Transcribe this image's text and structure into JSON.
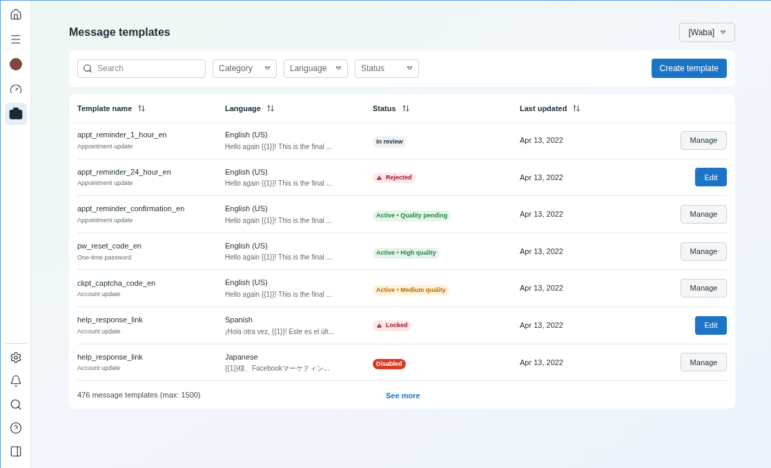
{
  "sidebar": {
    "top_items": [
      {
        "selected": false
      },
      {
        "selected": false
      },
      {
        "selected": false
      },
      {
        "selected": false
      },
      {
        "selected": true
      }
    ],
    "bottom_items": [
      {
        "selected": false
      },
      {
        "selected": false
      },
      {
        "selected": false
      },
      {
        "selected": false
      },
      {
        "selected": false
      }
    ]
  },
  "page": {
    "title": "Message templates",
    "account_selector": "[Waba]"
  },
  "filters": {
    "search": {
      "placeholder": "Search"
    },
    "dropdowns": [
      "Category",
      "Language",
      "Status"
    ],
    "create_button": "Create template"
  },
  "table": {
    "columns": [
      "Template name",
      "Language",
      "Status",
      "Last updated"
    ],
    "rows": [
      {
        "name": "appt_reminder_1_hour_en",
        "category": "Appointment update",
        "language": "English (US)",
        "preview": "Hello again {{1}}! This is the final ...",
        "status": {
          "label": "In review",
          "kind": "neutral"
        },
        "updated": "Apr 13, 2022",
        "action": {
          "label": "Manage",
          "kind": "secondary"
        }
      },
      {
        "name": "appt_reminder_24_hour_en",
        "category": "Appointment update",
        "language": "English (US)",
        "preview": "Hello again {{1}}! This is the final ...",
        "status": {
          "label": "Rejected",
          "kind": "error"
        },
        "updated": "Apr 13, 2022",
        "action": {
          "label": "Edit",
          "kind": "primary"
        }
      },
      {
        "name": "appt_reminder_confirmation_en",
        "category": "Appointment update",
        "language": "English (US)",
        "preview": "Hello again {{1}}! This is the final ...",
        "status": {
          "label": "Active • Quality pending",
          "kind": "success"
        },
        "updated": "Apr 13, 2022",
        "action": {
          "label": "Manage",
          "kind": "secondary"
        }
      },
      {
        "name": "pw_reset_code_en",
        "category": "One-time password",
        "language": "English (US)",
        "preview": "Hello again {{1}}! This is the final ...",
        "status": {
          "label": "Active • High quality",
          "kind": "success"
        },
        "updated": "Apr 13, 2022",
        "action": {
          "label": "Manage",
          "kind": "secondary"
        }
      },
      {
        "name": "ckpt_captcha_code_en",
        "category": "Account update",
        "language": "English (US)",
        "preview": "Hello again {{1}}! This is the final ...",
        "status": {
          "label": "Active • Medium quality",
          "kind": "warning"
        },
        "updated": "Apr 13, 2022",
        "action": {
          "label": "Manage",
          "kind": "secondary"
        }
      },
      {
        "name": "help_response_link",
        "category": "Account update",
        "language": "Spanish",
        "preview": "¡Hola otra vez, {{1}}! Este es el últ...",
        "status": {
          "label": "Locked",
          "kind": "error"
        },
        "updated": "Apr 13, 2022",
        "action": {
          "label": "Edit",
          "kind": "primary"
        }
      },
      {
        "name": "help_response_link",
        "category": "Account update",
        "language": "Japanese",
        "preview": "{{1}}様、Facebookマーケティン...",
        "status": {
          "label": "Disabled",
          "kind": "danger"
        },
        "updated": "Apr 13, 2022",
        "action": {
          "label": "Manage",
          "kind": "secondary"
        }
      }
    ],
    "footer": {
      "count": "476 message templates (max: 1500)",
      "see_more": "See more"
    }
  }
}
